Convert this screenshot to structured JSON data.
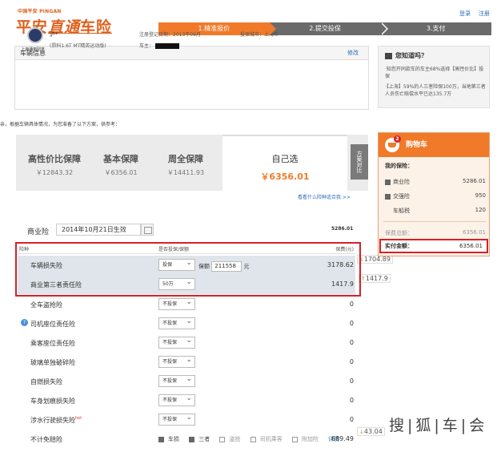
{
  "header": {
    "brand_small": "中国平安 PINGAN",
    "brand_main_1": "平安",
    "brand_main_2": "直通",
    "brand_main_3": "车险",
    "login": "登录",
    "register": "注册",
    "steps": [
      "1.精准报价",
      "2.提交投保",
      "3.支付"
    ]
  },
  "vehicle": {
    "title": "车辆信息",
    "edit": "修改",
    "maker": "上海通用别克",
    "plate": "沪*",
    "model": "(昂科1.6T MT精英运动版)",
    "reg_date": "注册登记日期：2013年09月",
    "owner_label": "车主：",
    "city": "投保城市：上海市"
  },
  "note": "亲，根据车辆具体情况，为您准备了以下方案，供参考：",
  "plans": [
    {
      "name": "高性价比保障",
      "price": "￥12843.32"
    },
    {
      "name": "基本保障",
      "price": "￥6356.01"
    },
    {
      "name": "周全保障",
      "price": "￥14411.93"
    },
    {
      "name": "自己选",
      "price": "￥6356.01"
    }
  ],
  "compare_label": "方案对比",
  "which_link": "看看什么险种适合我 >>",
  "business": {
    "label": "商业险",
    "date": "2014年10月21日生效",
    "total": "5286.01"
  },
  "table": {
    "col_name": "险种",
    "col_choice": "是否投保/保额",
    "col_fee": "保费(元)",
    "rows": [
      {
        "name": "车辆损失险",
        "choice": "投保",
        "extra_label": "保额",
        "extra_value": "211558",
        "extra_unit": "元",
        "fee": "3178.62",
        "diff": "1704.89"
      },
      {
        "name": "商业第三者责任险",
        "choice": "50万",
        "fee": "1417.9",
        "diff": "1417.9"
      },
      {
        "name": "全车盗抢险",
        "choice": "不投保",
        "fee": "0"
      },
      {
        "name": "司机座位责任险",
        "choice": "不投保",
        "fee": "0"
      },
      {
        "name": "乘客座位责任险",
        "choice": "不投保",
        "fee": "0"
      },
      {
        "name": "玻璃单独破碎险",
        "choice": "不投保",
        "fee": "0"
      },
      {
        "name": "自燃损失险",
        "choice": "不投保",
        "fee": "0"
      },
      {
        "name": "车身划痕损失险",
        "choice": "不投保",
        "fee": "0"
      },
      {
        "name": "涉水行驶损失险",
        "hot": "hot",
        "choice": "不投保",
        "fee": "0"
      },
      {
        "name": "不计免赔险",
        "fee": "689.49",
        "diff": "43.04"
      }
    ],
    "deductible_options": [
      "车损",
      "三者",
      "盗抢",
      "司机乘客",
      "附加险"
    ],
    "detail_link": "详情"
  },
  "know": {
    "title": "您知道吗？",
    "p1": "·知您开同款车的车主68%选择【高性价比】投保",
    "p2": "·【上海】59%的人三者险保100万，当地第三者人员伤亡赔偿水平已达135.7万"
  },
  "cart": {
    "title": "购物车",
    "badge": "2",
    "my_label": "我的保险：",
    "items": [
      {
        "name": "商业险",
        "value": "5286.01"
      },
      {
        "name": "交强险",
        "value": "950"
      },
      {
        "name": "车船税",
        "value": "120"
      }
    ],
    "total_label": "保费总额：",
    "total_value": "6356.01",
    "pay_label": "实付金额：",
    "pay_value": "6356.01"
  },
  "watermark": "搜|狐|车|会",
  "colors": {
    "accent": "#f07a2a",
    "highlight": "#d82027",
    "link": "#2a6db5"
  }
}
